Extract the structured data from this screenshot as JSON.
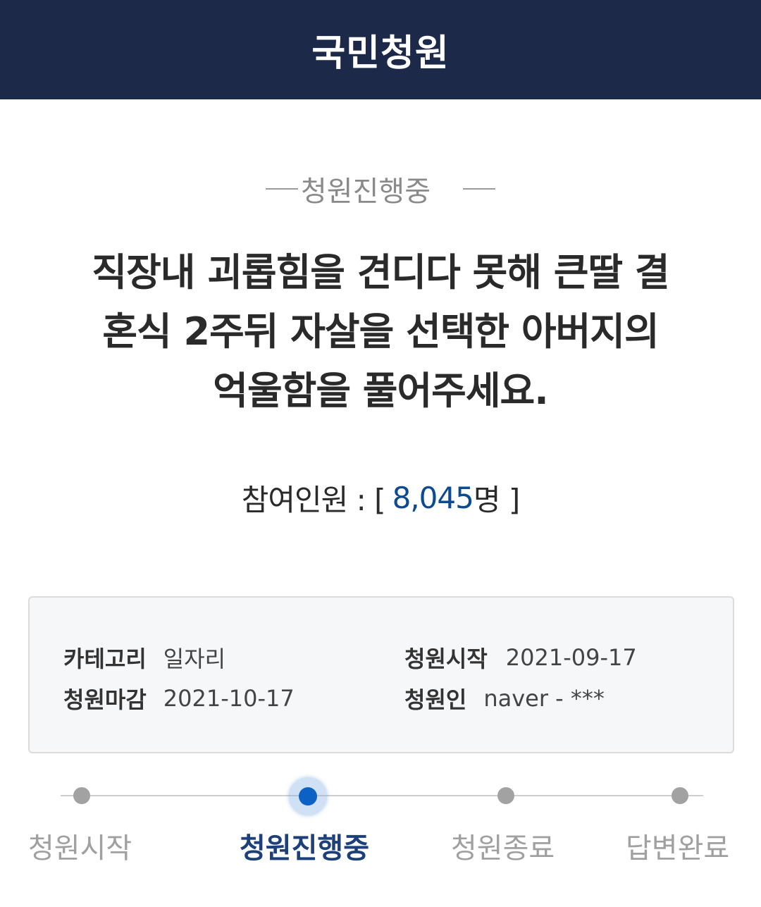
{
  "header": {
    "title": "국민청원"
  },
  "status": {
    "label": "청원진행중"
  },
  "petition": {
    "title_lines": [
      "직장내 괴롭힘을 견디다 못해 큰딸 결",
      "혼식 2주뒤 자살을 선택한 아버지의",
      "억울함을 풀어주세요."
    ]
  },
  "participants": {
    "label": "참여인원 : [",
    "count": "8,045",
    "unit": "명 ]"
  },
  "info": {
    "category_label": "카테고리",
    "category_value": "일자리",
    "start_label": "청원시작",
    "start_value": "2021-09-17",
    "end_label": "청원마감",
    "end_value": "2021-10-17",
    "author_label": "청원인",
    "author_value": "naver - ***"
  },
  "progress": {
    "steps": [
      {
        "label": "청원시작",
        "active": false
      },
      {
        "label": "청원진행중",
        "active": true
      },
      {
        "label": "청원종료",
        "active": false
      },
      {
        "label": "답변완료",
        "active": false
      }
    ]
  },
  "colors": {
    "header_bg": "#1d2948",
    "accent_count": "#0c4a92",
    "active_step": "#0b62c4",
    "inactive_step": "#a2a2a2"
  }
}
